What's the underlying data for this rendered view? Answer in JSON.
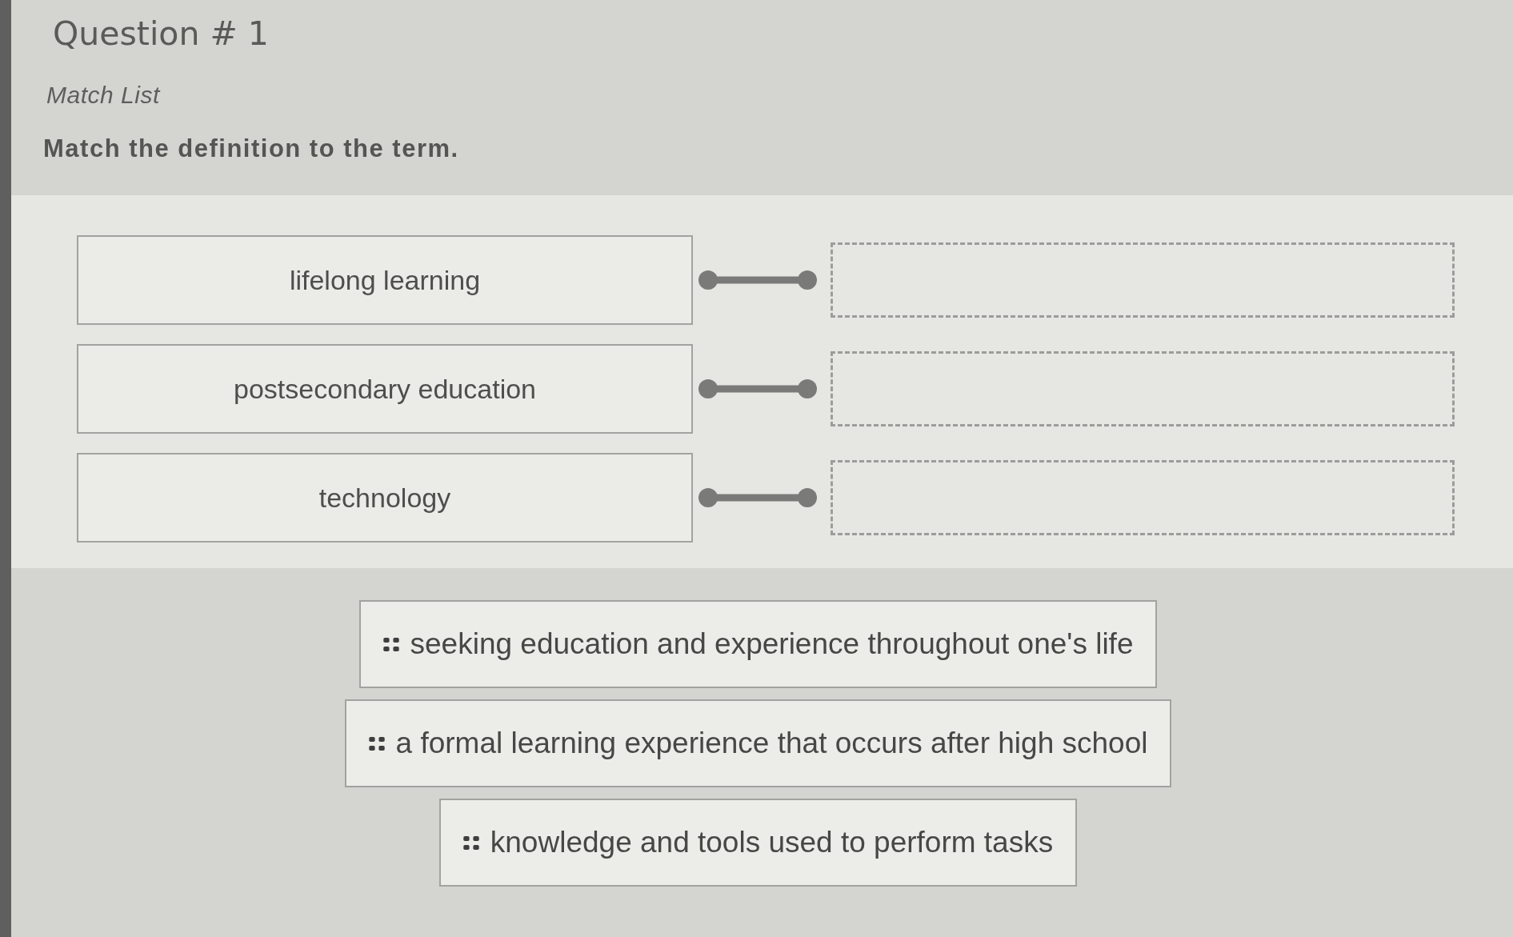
{
  "question": {
    "title": "Question # 1",
    "type_label": "Match List",
    "instructions": "Match the definition to the term."
  },
  "terms": [
    {
      "label": "lifelong learning"
    },
    {
      "label": "postsecondary education"
    },
    {
      "label": "technology"
    }
  ],
  "definitions": [
    {
      "text": "seeking education and experience throughout one's life"
    },
    {
      "text": "a formal learning experience that occurs after high school"
    },
    {
      "text": "knowledge and tools used to perform tasks"
    }
  ]
}
